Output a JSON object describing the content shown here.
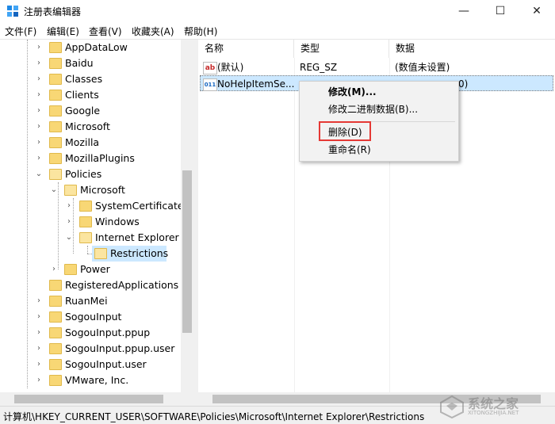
{
  "window": {
    "title": "注册表编辑器",
    "minimize_glyph": "—",
    "maximize_glyph": "☐",
    "close_glyph": "✕"
  },
  "menu": [
    "文件(F)",
    "编辑(E)",
    "查看(V)",
    "收藏夹(A)",
    "帮助(H)"
  ],
  "tree": {
    "items": [
      {
        "label": "AppDataLow",
        "chevron": "›"
      },
      {
        "label": "Baidu",
        "chevron": "›"
      },
      {
        "label": "Classes",
        "chevron": "›"
      },
      {
        "label": "Clients",
        "chevron": "›"
      },
      {
        "label": "Google",
        "chevron": "›"
      },
      {
        "label": "Microsoft",
        "chevron": "›"
      },
      {
        "label": "Mozilla",
        "chevron": "›"
      },
      {
        "label": "MozillaPlugins",
        "chevron": "›"
      },
      {
        "label": "Policies",
        "chevron": "⌄"
      },
      {
        "label": "Microsoft",
        "chevron": "⌄"
      },
      {
        "label": "SystemCertificates",
        "chevron": "›"
      },
      {
        "label": "Windows",
        "chevron": "›"
      },
      {
        "label": "Internet Explorer",
        "chevron": "⌄"
      },
      {
        "label": "Restrictions",
        "chevron": ""
      },
      {
        "label": "Power",
        "chevron": "›"
      },
      {
        "label": "RegisteredApplications",
        "chevron": ""
      },
      {
        "label": "RuanMei",
        "chevron": "›"
      },
      {
        "label": "SogouInput",
        "chevron": "›"
      },
      {
        "label": "SogouInput.ppup",
        "chevron": "›"
      },
      {
        "label": "SogouInput.ppup.user",
        "chevron": "›"
      },
      {
        "label": "SogouInput.user",
        "chevron": "›"
      },
      {
        "label": "VMware, Inc.",
        "chevron": "›"
      }
    ]
  },
  "list": {
    "columns": [
      "名称",
      "类型",
      "数据"
    ],
    "rows": [
      {
        "icon": "ab",
        "name": "(默认)",
        "type": "REG_SZ",
        "data": "(数值未设置)"
      },
      {
        "icon": "011",
        "name": "NoHelpItemSe...",
        "type": "",
        "data": "0)"
      }
    ]
  },
  "context_menu": {
    "items": [
      "修改(M)...",
      "修改二进制数据(B)...",
      "删除(D)",
      "重命名(R)"
    ]
  },
  "status": {
    "path": "计算机\\HKEY_CURRENT_USER\\SOFTWARE\\Policies\\Microsoft\\Internet Explorer\\Restrictions"
  },
  "watermark": {
    "text": "系统之家",
    "sub": "XITONGZHIJIA.NET"
  }
}
